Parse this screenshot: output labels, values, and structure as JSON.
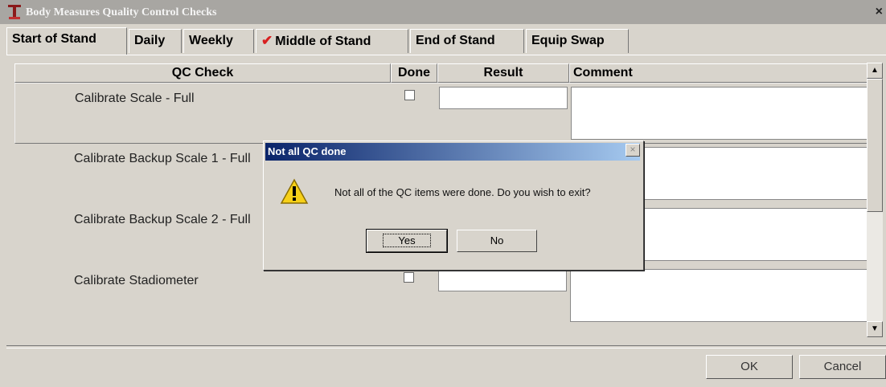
{
  "window": {
    "title": "Body Measures Quality Control Checks",
    "close": "×"
  },
  "tabs": [
    {
      "label": "Start of Stand",
      "active": true
    },
    {
      "label": "Daily"
    },
    {
      "label": "Weekly"
    },
    {
      "label": "Middle of Stand",
      "check": "✔"
    },
    {
      "label": "End of Stand"
    },
    {
      "label": "Equip Swap"
    }
  ],
  "table": {
    "headers": {
      "qc": "QC Check",
      "done": "Done",
      "result": "Result",
      "comment": "Comment"
    },
    "rows": [
      {
        "label": "Calibrate Scale - Full",
        "done": false,
        "result": "",
        "comment": ""
      },
      {
        "label": "Calibrate Backup Scale 1 - Full",
        "done": false,
        "result": "",
        "comment": ""
      },
      {
        "label": "Calibrate Backup Scale 2 - Full",
        "done": false,
        "result": "",
        "comment": ""
      },
      {
        "label": "Calibrate Stadiometer",
        "done": false,
        "result": "",
        "comment": ""
      }
    ]
  },
  "scrollbar": {
    "up": "▲",
    "down": "▼"
  },
  "buttons": {
    "ok": "OK",
    "cancel": "Cancel"
  },
  "dialog": {
    "title": "Not all QC done",
    "close": "×",
    "message": "Not all of the QC items were done. Do you wish to exit?",
    "yes": "Yes",
    "no": "No"
  },
  "colors": {
    "warning": "#f7d018",
    "accent": "#0a246a"
  }
}
